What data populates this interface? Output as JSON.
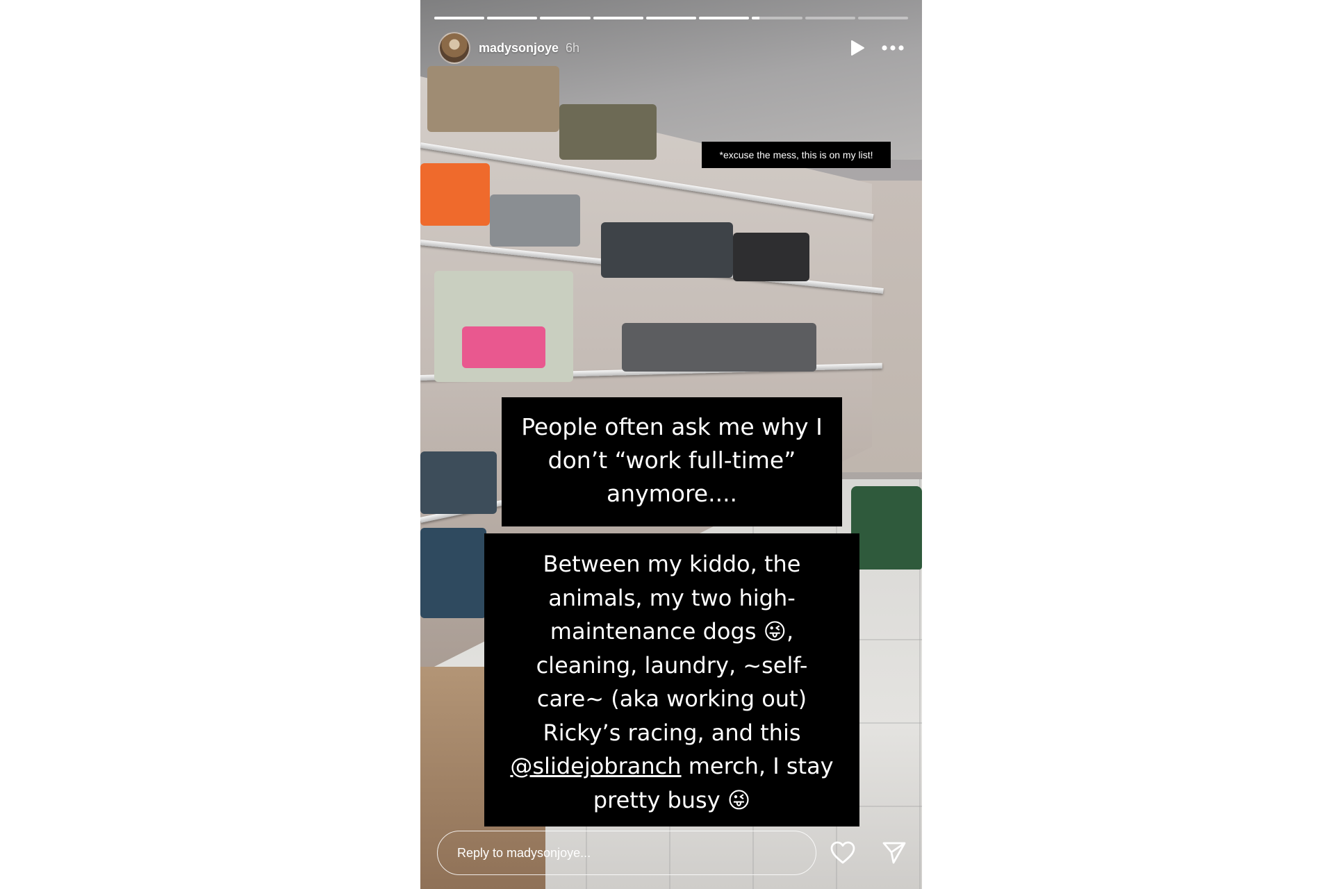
{
  "progress": {
    "total_segments": 9,
    "completed_segments": 6,
    "current_segment_progress": 0.15
  },
  "header": {
    "username": "madysonjoye",
    "time_ago": "6h",
    "icons": [
      "play-icon",
      "more-icon"
    ]
  },
  "overlay_note": "*excuse the mess, this is on my list!",
  "caption1": {
    "lines": [
      "People often ask me why I",
      "don’t “work full-time”",
      "anymore...."
    ]
  },
  "caption2": {
    "line1": "Between my kiddo, the",
    "line2": "animals, my two high-",
    "line3_text": "maintenance dogs",
    "line3_emoji": "😜",
    "line3_tail": ",",
    "line4": "cleaning, laundry, ~self-",
    "line5": "care~ (aka working out)",
    "line6": "Ricky’s racing, and this",
    "line7_mention": "@slidejobranch",
    "line7_tail": " merch, I stay",
    "line8_text": "pretty busy",
    "line8_emoji": "😜"
  },
  "reply": {
    "placeholder": "Reply to madysonjoye...",
    "icons": [
      "heart-icon",
      "send-icon"
    ]
  },
  "colors": {
    "caption_bg": "#000000",
    "caption_text": "#ffffff",
    "page_bg": "#ffffff"
  }
}
